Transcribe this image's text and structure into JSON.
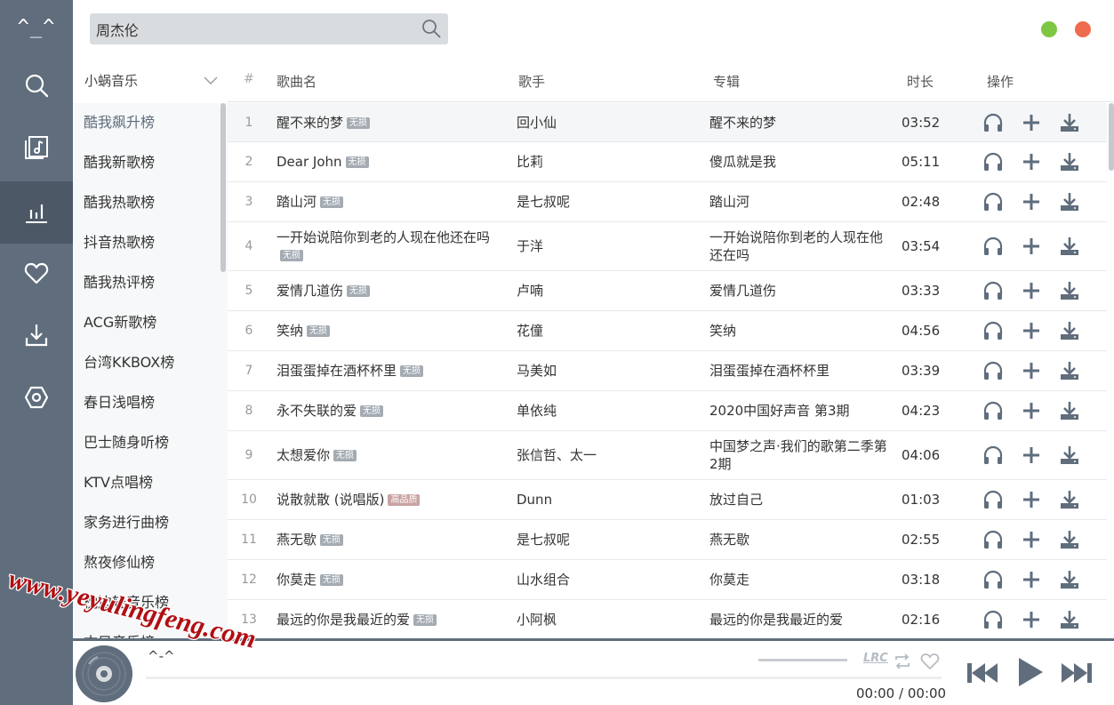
{
  "app": {
    "logo": "^_^",
    "colors": {
      "sidebar": "#5f6d7c",
      "accent_green": "#7ec742",
      "accent_red": "#ef6b4e"
    }
  },
  "nav": [
    {
      "name": "search",
      "icon": "search-icon"
    },
    {
      "name": "playlist",
      "icon": "music-list-icon"
    },
    {
      "name": "charts",
      "icon": "bar-chart-icon",
      "active": true
    },
    {
      "name": "favorites",
      "icon": "heart-icon"
    },
    {
      "name": "downloads",
      "icon": "download-icon"
    },
    {
      "name": "settings",
      "icon": "hexagon-settings-icon"
    }
  ],
  "search": {
    "value": "周杰伦"
  },
  "source": {
    "selected": "小蜗音乐"
  },
  "ranks": [
    "酷我飙升榜",
    "酷我新歌榜",
    "酷我热歌榜",
    "抖音热歌榜",
    "酷我热评榜",
    "ACG新歌榜",
    "台湾KKBOX榜",
    "春日浅唱榜",
    "巴士随身听榜",
    "KTV点唱榜",
    "家务进行曲榜",
    "熬夜修仙榜",
    "枕边轻音乐榜",
    "古风音乐榜"
  ],
  "table": {
    "headers": {
      "num": "#",
      "name": "歌曲名",
      "artist": "歌手",
      "album": "专辑",
      "duration": "时长",
      "ops": "操作"
    },
    "rows": [
      {
        "num": "1",
        "name": "醒不来的梦",
        "badge": "无损",
        "artist": "回小仙",
        "album": "醒不来的梦",
        "duration": "03:52"
      },
      {
        "num": "2",
        "name": "Dear John",
        "badge": "无损",
        "artist": "比莉",
        "album": "傻瓜就是我",
        "duration": "05:11"
      },
      {
        "num": "3",
        "name": "踏山河",
        "badge": "无损",
        "artist": "是七叔呢",
        "album": "踏山河",
        "duration": "02:48"
      },
      {
        "num": "4",
        "name": "一开始说陪你到老的人现在他还在吗",
        "badge": "无损",
        "artist": "于洋",
        "album": "一开始说陪你到老的人现在他还在吗",
        "duration": "03:54"
      },
      {
        "num": "5",
        "name": "爱情几道伤",
        "badge": "无损",
        "artist": "卢喃",
        "album": "爱情几道伤",
        "duration": "03:33"
      },
      {
        "num": "6",
        "name": "笑纳",
        "badge": "无损",
        "artist": "花僮",
        "album": "笑纳",
        "duration": "04:56"
      },
      {
        "num": "7",
        "name": "泪蛋蛋掉在酒杯杯里",
        "badge": "无损",
        "artist": "马美如",
        "album": "泪蛋蛋掉在酒杯杯里",
        "duration": "03:39"
      },
      {
        "num": "8",
        "name": "永不失联的爱",
        "badge": "无损",
        "artist": "单依纯",
        "album": "2020中国好声音 第3期",
        "duration": "04:23"
      },
      {
        "num": "9",
        "name": "太想爱你",
        "badge": "无损",
        "artist": "张信哲、太一",
        "album": "中国梦之声·我们的歌第二季第2期",
        "duration": "04:06"
      },
      {
        "num": "10",
        "name": "说散就散 (说唱版)",
        "badge": "高品质",
        "artist": "Dunn",
        "album": "放过自己",
        "duration": "01:03"
      },
      {
        "num": "11",
        "name": "燕无歇",
        "badge": "无损",
        "artist": "是七叔呢",
        "album": "燕无歇",
        "duration": "02:55"
      },
      {
        "num": "12",
        "name": "你莫走",
        "badge": "无损",
        "artist": "山水组合",
        "album": "你莫走",
        "duration": "03:18"
      },
      {
        "num": "13",
        "name": "最远的你是我最近的爱",
        "badge": "无损",
        "artist": "小阿枫",
        "album": "最远的你是我最近的爱",
        "duration": "02:16"
      }
    ]
  },
  "player": {
    "title": "^-^",
    "current_time": "00:00",
    "separator": "/",
    "total_time": "00:00",
    "lrc_label": "LRC",
    "progress": 0
  },
  "watermark": "www.yeyulingfeng.com"
}
